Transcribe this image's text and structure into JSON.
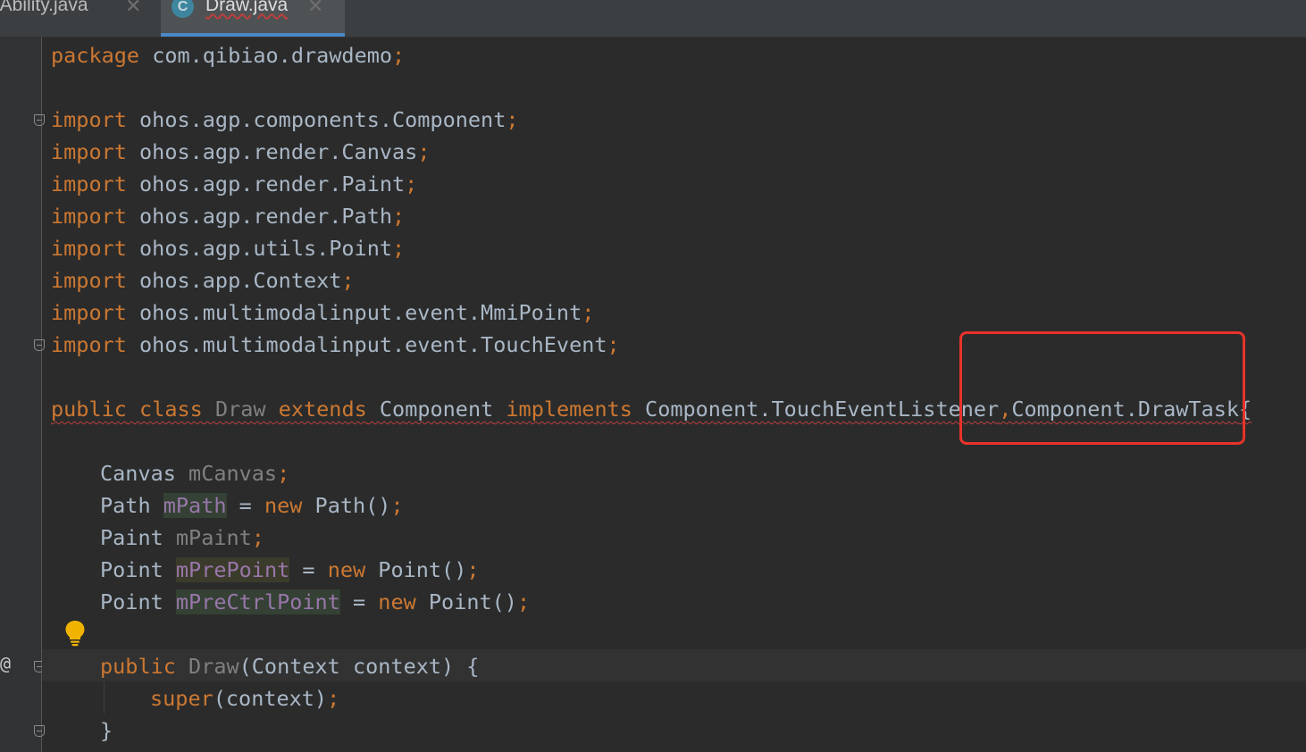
{
  "tabs": [
    {
      "label": "nAbility.java",
      "close": "✕",
      "active": false
    },
    {
      "label": "Draw.java",
      "close": "✕",
      "active": true,
      "icon_letter": "C"
    }
  ],
  "gutter": {
    "override_marker": "@"
  },
  "colors": {
    "keyword": "#cc7832",
    "text": "#a9b7c6",
    "field": "#9876aa",
    "unused": "#808080",
    "error_underline": "#bc3f3c",
    "annotation_box": "#e8332a",
    "tab_accent": "#4a88c7"
  },
  "icons": [
    "class-file-icon",
    "close-icon",
    "fold-icon",
    "lightbulb-icon",
    "override-icon"
  ],
  "code": {
    "line1": {
      "kw": "package",
      "rest": " com.qibiao.drawdemo",
      "semi": ";"
    },
    "line3": {
      "kw": "import",
      "rest": " ohos.agp.components.Component",
      "semi": ";"
    },
    "line4": {
      "kw": "import",
      "rest": " ohos.agp.render.Canvas",
      "semi": ";"
    },
    "line5": {
      "kw": "import",
      "rest": " ohos.agp.render.Paint",
      "semi": ";"
    },
    "line6": {
      "kw": "import",
      "rest": " ohos.agp.render.Path",
      "semi": ";"
    },
    "line7": {
      "kw": "import",
      "rest": " ohos.agp.utils.Point",
      "semi": ";"
    },
    "line8": {
      "kw": "import",
      "rest": " ohos.app.Context",
      "semi": ";"
    },
    "line9": {
      "kw": "import",
      "rest": " ohos.multimodalinput.event.MmiPoint",
      "semi": ";"
    },
    "line10": {
      "kw": "import",
      "rest": " ohos.multimodalinput.event.TouchEvent",
      "semi": ";"
    },
    "line12": {
      "kw_public": "public",
      "kw_class": "class",
      "name": "Draw",
      "kw_extends": "extends",
      "superclass": "Component",
      "kw_implements": "implements",
      "iface1": "Component.TouchEventListener",
      "comma": ",",
      "iface2": "Component.DrawTask",
      "brace": "{"
    },
    "line14": {
      "type": "Canvas",
      "name": "mCanvas",
      "semi": ";"
    },
    "line15": {
      "type": "Path",
      "name": "mPath",
      "eq": " = ",
      "kw_new": "new",
      "ctor": " Path()",
      "semi": ";"
    },
    "line16": {
      "type": "Paint",
      "name": "mPaint",
      "semi": ";"
    },
    "line17": {
      "type": "Point",
      "name": "mPrePoint",
      "eq": " = ",
      "kw_new": "new",
      "ctor": " Point()",
      "semi": ";"
    },
    "line18": {
      "type": "Point",
      "name": "mPreCtrlPoint",
      "eq": " = ",
      "kw_new": "new",
      "ctor": " Point()",
      "semi": ";"
    },
    "line20": {
      "kw_public": "public",
      "name": "Draw",
      "params": "(Context context) {"
    },
    "line21": {
      "kw_super": "super",
      "args": "(context)",
      "semi": ";"
    },
    "line22": {
      "brace": "}"
    }
  }
}
